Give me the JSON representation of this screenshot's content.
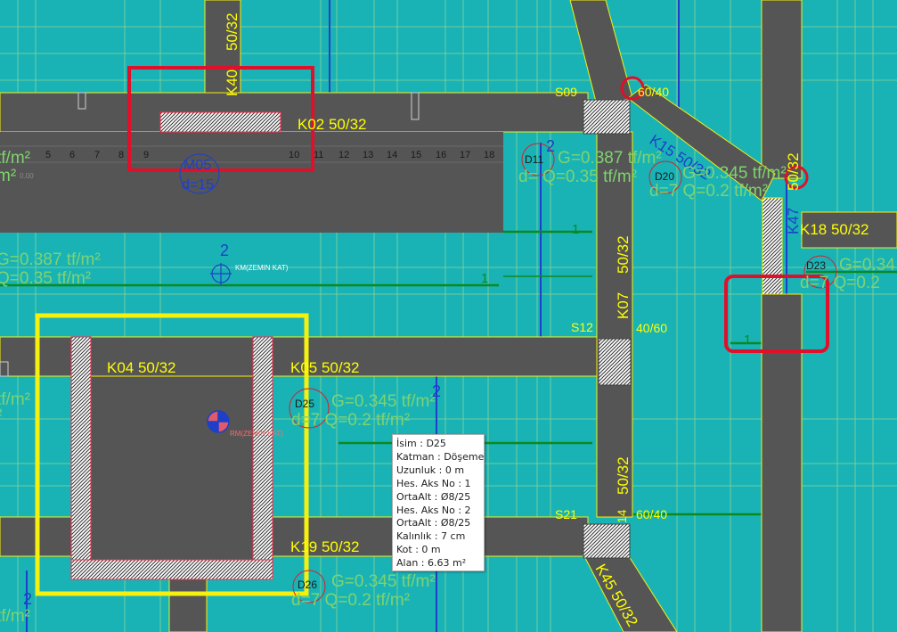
{
  "colors": {
    "background": "#19b3b6",
    "beam": "#555555",
    "beam_label": "#ffff00",
    "load_label": "#7fd36f",
    "axis_line": "#1e3fc9",
    "select_red": "#e0102a",
    "select_yellow": "#f5f010",
    "slab_circle": "#d8202c"
  },
  "beams": {
    "k02": "K02   50/32",
    "k04": "K04   50/32",
    "k05": "K05   50/32",
    "k19": "K19   50/32",
    "k18": "K18   50/32",
    "k07_name": "K07",
    "k07_size": "50/32",
    "k15": "K15 50/32",
    "k47_name": "K47",
    "k47_size": "50/32",
    "k40_name": "K40",
    "k40_size": "50/32",
    "k45": "K45   50/32",
    "lower_right_size": "50/32"
  },
  "columns": {
    "s09": "S09",
    "s12": "S12",
    "s21": "S21",
    "s12_size": "40/60",
    "s09_size": "60/40",
    "s21_size": "60/40",
    "s21_prefix": "14"
  },
  "slab": {
    "m05_name": "M05",
    "m05_thickness": "d=15",
    "stair_numbers": [
      "5",
      "6",
      "7",
      "8",
      "9",
      "10",
      "11",
      "12",
      "13",
      "14",
      "15",
      "16",
      "17",
      "18"
    ],
    "tf_left_top": "tf/m²",
    "tf_left_top2": "m²",
    "tf_left_mid": "tf/m²",
    "tf_left_mid2": "²"
  },
  "loads": {
    "d11_name": "D11",
    "d11_g": "G=0.387 tf/m²",
    "d11_q": "d=  Q=0.35 tf/m²",
    "d20_name": "D20",
    "d20_g": "G=0.345 tf/m²",
    "d20_q": "d=7 Q=0.2 tf/m²",
    "d23_name": "D23",
    "d23_g": "G=0.34",
    "d23_q": "d=7 Q=0.2",
    "left_g": "G=0.387 tf/m²",
    "left_q": "Q=0.35 tf/m²",
    "d25_name": "D25",
    "d25_g": "G=0.345 tf/m²",
    "d25_q": "d=7 Q=0.2 tf/m²",
    "d26_name": "D26",
    "d26_g": "G=0.345 tf/m²",
    "d26_q": "d=7 Q=0.2 tf/m²",
    "bottom_left": "tf/m²",
    "axis_2_a": "2",
    "axis_2_b": "2",
    "axis_2_c": "2",
    "axis_1_a": "1",
    "axis_1_b": "1",
    "axis_1_c": "1",
    "axis_2_d": "2"
  },
  "markers": {
    "zemin_kat_1": "KM(ZEMIN KAT)",
    "zemin_kat_2": "RM(ZEMIN KAT)",
    "stair_level": "0.00"
  },
  "tooltip": {
    "isim": "İsim : D25",
    "katman": "Katman : Döşeme",
    "uzunluk": "Uzunluk : 0 m",
    "hes_aks_1": "Hes. Aks No : 1",
    "orta_alt_1": "OrtaAlt : Ø8/25",
    "hes_aks_2": "Hes. Aks No : 2",
    "orta_alt_2": "OrtaAlt : Ø8/25",
    "kalinlik": "Kalınlık : 7 cm",
    "kot": "Kot : 0 m",
    "alan": "Alan : 6.63 m²"
  }
}
